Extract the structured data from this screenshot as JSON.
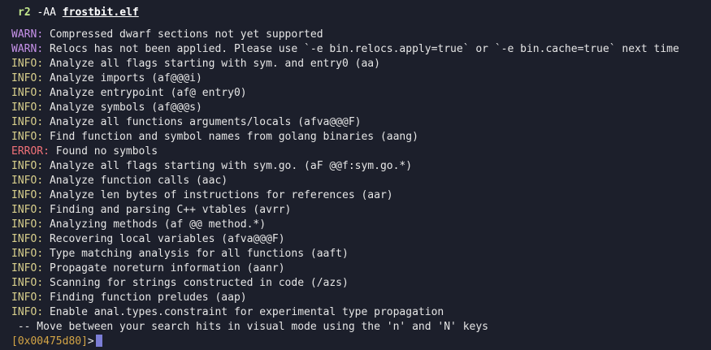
{
  "command": {
    "program": "r2",
    "args": "-AA",
    "file": "frostbit.elf"
  },
  "log": [
    {
      "level": "WARN",
      "text": "Compressed dwarf sections not yet supported"
    },
    {
      "level": "WARN",
      "text": "Relocs has not been applied. Please use `-e bin.relocs.apply=true` or `-e bin.cache=true` next time"
    },
    {
      "level": "INFO",
      "text": "Analyze all flags starting with sym. and entry0 (aa)"
    },
    {
      "level": "INFO",
      "text": "Analyze imports (af@@@i)"
    },
    {
      "level": "INFO",
      "text": "Analyze entrypoint (af@ entry0)"
    },
    {
      "level": "INFO",
      "text": "Analyze symbols (af@@@s)"
    },
    {
      "level": "INFO",
      "text": "Analyze all functions arguments/locals (afva@@@F)"
    },
    {
      "level": "INFO",
      "text": "Find function and symbol names from golang binaries (aang)"
    },
    {
      "level": "ERROR",
      "text": "Found no symbols"
    },
    {
      "level": "INFO",
      "text": "Analyze all flags starting with sym.go. (aF @@f:sym.go.*)"
    },
    {
      "level": "INFO",
      "text": "Analyze function calls (aac)"
    },
    {
      "level": "INFO",
      "text": "Analyze len bytes of instructions for references (aar)"
    },
    {
      "level": "INFO",
      "text": "Finding and parsing C++ vtables (avrr)"
    },
    {
      "level": "INFO",
      "text": "Analyzing methods (af @@ method.*)"
    },
    {
      "level": "INFO",
      "text": "Recovering local variables (afva@@@F)"
    },
    {
      "level": "INFO",
      "text": "Type matching analysis for all functions (aaft)"
    },
    {
      "level": "INFO",
      "text": "Propagate noreturn information (aanr)"
    },
    {
      "level": "INFO",
      "text": "Scanning for strings constructed in code (/azs)"
    },
    {
      "level": "INFO",
      "text": "Finding function preludes (aap)"
    },
    {
      "level": "INFO",
      "text": "Enable anal.types.constraint for experimental type propagation"
    }
  ],
  "hint": " -- Move between your search hits in visual mode using the 'n' and 'N' keys",
  "prompt": {
    "address": "[0x00475d80]",
    "symbol": ">"
  },
  "colors": {
    "background": "#1c1f2b",
    "warn": "#c792ea",
    "info": "#d8cf8c",
    "error": "#f07178",
    "prompt_address": "#d4a546",
    "cursor": "#7b7dd6"
  }
}
